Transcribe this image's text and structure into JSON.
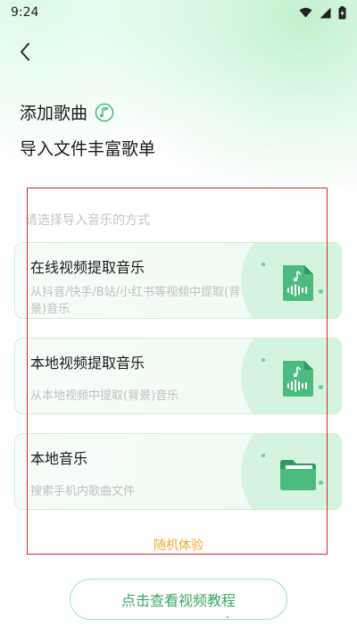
{
  "status_bar": {
    "time": "9:24",
    "icons": [
      "wifi-icon",
      "signal-icon",
      "battery-icon"
    ]
  },
  "header": {
    "back_icon": "chevron-left-icon",
    "title": "添加歌曲",
    "title_icon": "music-note-icon",
    "subtitle": "导入文件丰富歌单"
  },
  "main": {
    "hint": "请选择导入音乐的方式",
    "options": [
      {
        "title": "在线视频提取音乐",
        "description": "从抖音/快手/B站/小红书等视频中提取(背景)音乐",
        "icon": "audio-file-icon"
      },
      {
        "title": "本地视频提取音乐",
        "description": "从本地视频中提取(背景)音乐",
        "icon": "audio-file-icon"
      },
      {
        "title": "本地音乐",
        "description": "搜索手机内歌曲文件",
        "icon": "folder-icon"
      }
    ],
    "random_link": "随机体验"
  },
  "footer": {
    "tutorial_button": "点击查看视频教程"
  },
  "colors": {
    "accent": "#4cbb7f",
    "accent_text": "#3ca868",
    "random_link": "#f2a93b",
    "highlight_frame": "#e0242a"
  }
}
